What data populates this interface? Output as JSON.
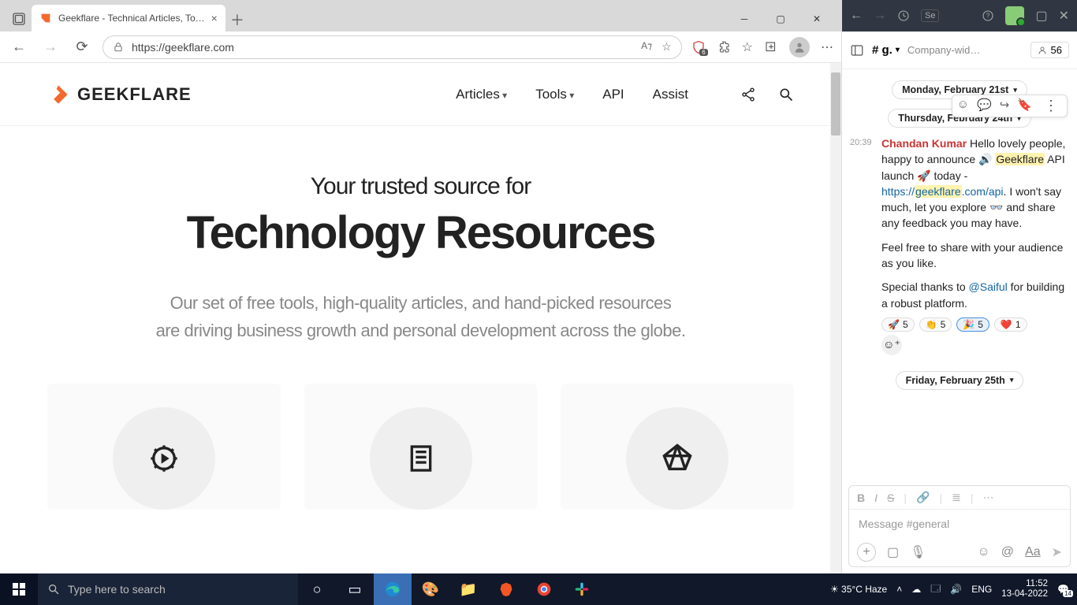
{
  "browser": {
    "tab_title": "Geekflare - Technical Articles, To…",
    "url": "https://geekflare.com",
    "nav": {
      "articles": "Articles",
      "tools": "Tools",
      "api": "API",
      "assist": "Assist"
    },
    "hero": {
      "sub": "Your trusted source for",
      "main": "Technology Resources",
      "body1": "Our set of free tools, high-quality articles, and hand-picked resources",
      "body2": "are driving business growth and personal development across the globe."
    },
    "security_badge": "6"
  },
  "chat": {
    "channel": "# g.",
    "topic": "Company-wid…",
    "members": "56",
    "date1": "Monday, February 21st",
    "date2": "Thursday, February 24th",
    "date3": "Friday, February 25th",
    "time": "20:39",
    "sender": "Chandan Kumar",
    "body_lead": "Hello lovely people, happy to announce 🔊 ",
    "hl1": "Geekflare",
    "after_hl1": " API launch 🚀 today - ",
    "link_pre": "https://",
    "link_hl": "geekflare",
    "link_post": ".com/api",
    "after_link": ". I won't say much, let you explore 👓 and share any feedback you may have.",
    "para2": "Feel free to share with your audience as you like.",
    "para3_pre": "Special thanks to ",
    "mention": "@Saiful",
    "para3_post": " for building a robust platform.",
    "reactions": [
      {
        "emoji": "🚀",
        "count": "5",
        "active": false
      },
      {
        "emoji": "👏",
        "count": "5",
        "active": false
      },
      {
        "emoji": "🎉",
        "count": "5",
        "active": true
      },
      {
        "emoji": "❤️",
        "count": "1",
        "active": false
      }
    ],
    "compose_placeholder": "Message #general"
  },
  "taskbar": {
    "search_placeholder": "Type here to search",
    "weather": "35°C Haze",
    "lang": "ENG",
    "time": "11:52",
    "date": "13-04-2022"
  }
}
